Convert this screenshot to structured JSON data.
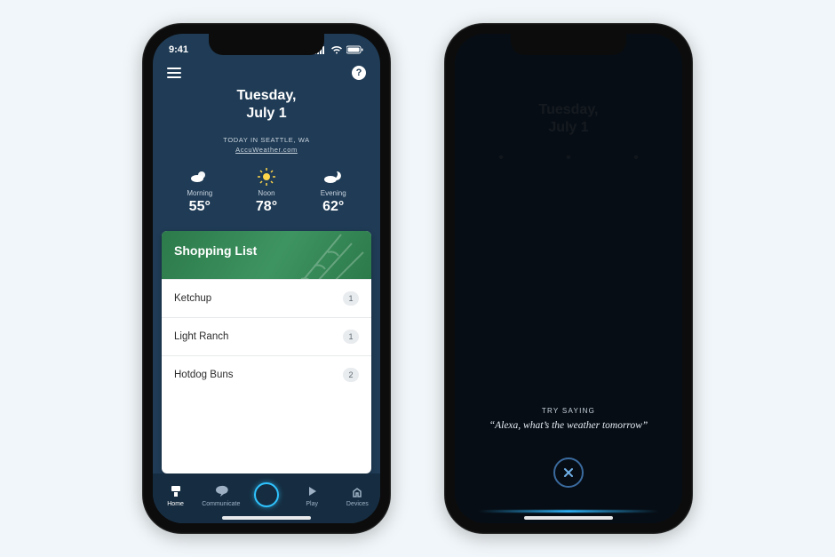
{
  "statusbar": {
    "time": "9:41"
  },
  "home": {
    "date_line1": "Tuesday,",
    "date_line2": "July 1",
    "location_line": "TODAY IN SEATTLE, WA",
    "source": "AccuWeather.com",
    "forecast": [
      {
        "label": "Morning",
        "temp": "55°",
        "icon": "partly-cloudy"
      },
      {
        "label": "Noon",
        "temp": "78°",
        "icon": "sunny"
      },
      {
        "label": "Evening",
        "temp": "62°",
        "icon": "night-cloudy"
      }
    ],
    "card_title": "Shopping List",
    "items": [
      {
        "name": "Ketchup",
        "count": "1"
      },
      {
        "name": "Light Ranch",
        "count": "1"
      },
      {
        "name": "Hotdog Buns",
        "count": "2"
      }
    ],
    "tabs": [
      {
        "label": "Home"
      },
      {
        "label": "Communicate"
      },
      {
        "label": ""
      },
      {
        "label": "Play"
      },
      {
        "label": "Devices"
      }
    ]
  },
  "voice": {
    "hint_label": "TRY SAYING",
    "hint_quote": "“Alexa, what’s the weather tomorrow”"
  }
}
